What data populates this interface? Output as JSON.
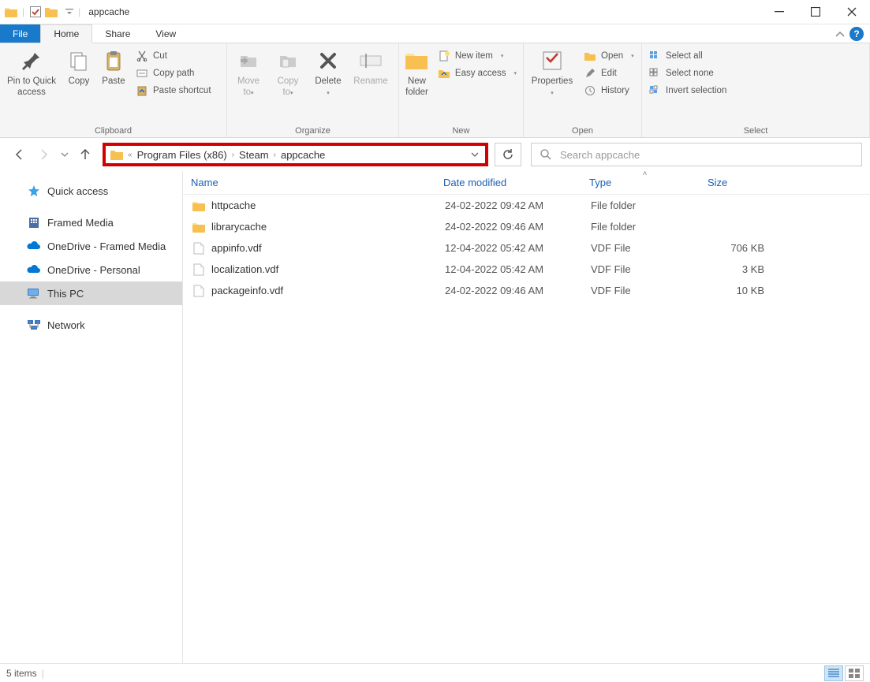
{
  "window": {
    "title": "appcache"
  },
  "tabs": {
    "file": "File",
    "home": "Home",
    "share": "Share",
    "view": "View"
  },
  "ribbon": {
    "clipboard": {
      "label": "Clipboard",
      "pin": "Pin to Quick access",
      "copy": "Copy",
      "paste": "Paste",
      "cut": "Cut",
      "copypath": "Copy path",
      "pasteshortcut": "Paste shortcut"
    },
    "organize": {
      "label": "Organize",
      "moveto": "Move to",
      "copyto": "Copy to",
      "delete": "Delete",
      "rename": "Rename"
    },
    "new": {
      "label": "New",
      "newfolder": "New folder",
      "newitem": "New item",
      "easyaccess": "Easy access"
    },
    "open": {
      "label": "Open",
      "properties": "Properties",
      "open": "Open",
      "edit": "Edit",
      "history": "History"
    },
    "select": {
      "label": "Select",
      "all": "Select all",
      "none": "Select none",
      "invert": "Invert selection"
    }
  },
  "breadcrumb": {
    "items": [
      "Program Files (x86)",
      "Steam",
      "appcache"
    ]
  },
  "search": {
    "placeholder": "Search appcache"
  },
  "sidebar": {
    "items": [
      {
        "label": "Quick access",
        "icon": "star"
      },
      {
        "label": "Framed Media",
        "icon": "building"
      },
      {
        "label": "OneDrive - Framed Media",
        "icon": "cloud"
      },
      {
        "label": "OneDrive - Personal",
        "icon": "cloud"
      },
      {
        "label": "This PC",
        "icon": "pc",
        "selected": true
      },
      {
        "label": "Network",
        "icon": "network"
      }
    ]
  },
  "columns": {
    "name": "Name",
    "date": "Date modified",
    "type": "Type",
    "size": "Size"
  },
  "files": [
    {
      "name": "httpcache",
      "date": "24-02-2022 09:42 AM",
      "type": "File folder",
      "size": "",
      "icon": "folder"
    },
    {
      "name": "librarycache",
      "date": "24-02-2022 09:46 AM",
      "type": "File folder",
      "size": "",
      "icon": "folder"
    },
    {
      "name": "appinfo.vdf",
      "date": "12-04-2022 05:42 AM",
      "type": "VDF File",
      "size": "706 KB",
      "icon": "file"
    },
    {
      "name": "localization.vdf",
      "date": "12-04-2022 05:42 AM",
      "type": "VDF File",
      "size": "3 KB",
      "icon": "file"
    },
    {
      "name": "packageinfo.vdf",
      "date": "24-02-2022 09:46 AM",
      "type": "VDF File",
      "size": "10 KB",
      "icon": "file"
    }
  ],
  "status": {
    "count": "5 items"
  }
}
